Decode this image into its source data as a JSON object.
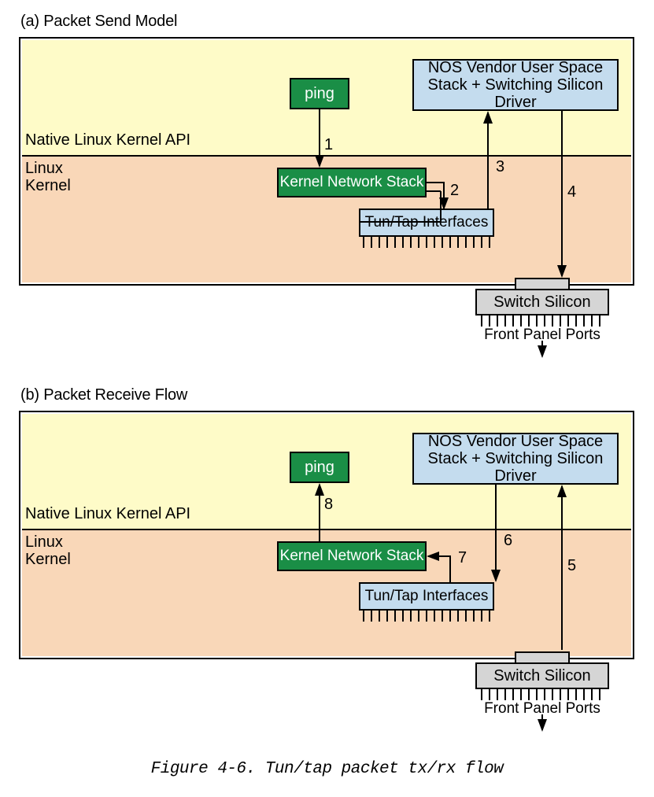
{
  "figure_caption": "Figure 4-6. Tun/tap packet tx/rx flow",
  "panels": {
    "a": {
      "title": "(a) Packet Send Model",
      "api_label": "Native Linux Kernel API",
      "kernel_label": "Linux\nKernel",
      "boxes": {
        "ping": "ping",
        "kernel_stack": "Kernel Network Stack",
        "tuntap": "Tun/Tap Interfaces",
        "nos": "NOS Vendor User Space Stack + Switching Silicon Driver",
        "silicon": "Switch Silicon",
        "front_ports": "Front Panel Ports"
      },
      "edge_labels": {
        "e1": "1",
        "e2": "2",
        "e3": "3",
        "e4": "4"
      }
    },
    "b": {
      "title": "(b) Packet Receive Flow",
      "api_label": "Native Linux Kernel API",
      "kernel_label": "Linux\nKernel",
      "boxes": {
        "ping": "ping",
        "kernel_stack": "Kernel Network Stack",
        "tuntap": "Tun/Tap Interfaces",
        "nos": "NOS Vendor User Space Stack + Switching Silicon Driver",
        "silicon": "Switch Silicon",
        "front_ports": "Front Panel Ports"
      },
      "edge_labels": {
        "e5": "5",
        "e6": "6",
        "e7": "7",
        "e8": "8"
      }
    }
  },
  "chart_data": {
    "type": "flow-diagram",
    "nodes": [
      {
        "id": "ping",
        "label": "ping",
        "layer": "user-space"
      },
      {
        "id": "kns",
        "label": "Kernel Network Stack",
        "layer": "linux-kernel"
      },
      {
        "id": "tuntap",
        "label": "Tun/Tap Interfaces",
        "layer": "linux-kernel"
      },
      {
        "id": "nos",
        "label": "NOS Vendor User Space Stack + Switching Silicon Driver",
        "layer": "user-space"
      },
      {
        "id": "silicon",
        "label": "Switch Silicon",
        "layer": "hardware"
      },
      {
        "id": "ports",
        "label": "Front Panel Ports",
        "layer": "hardware"
      }
    ],
    "layers": {
      "user-space": "Native Linux Kernel API",
      "linux-kernel": "Linux Kernel"
    },
    "send_flow_edges": [
      {
        "step": 1,
        "from": "ping",
        "to": "kns"
      },
      {
        "step": 2,
        "from": "kns",
        "to": "tuntap"
      },
      {
        "step": 3,
        "from": "tuntap",
        "to": "nos"
      },
      {
        "step": 4,
        "from": "nos",
        "to": "silicon"
      }
    ],
    "receive_flow_edges": [
      {
        "step": 5,
        "from": "silicon",
        "to": "nos"
      },
      {
        "step": 6,
        "from": "nos",
        "to": "tuntap"
      },
      {
        "step": 7,
        "from": "tuntap",
        "to": "kns"
      },
      {
        "step": 8,
        "from": "kns",
        "to": "ping"
      }
    ]
  }
}
